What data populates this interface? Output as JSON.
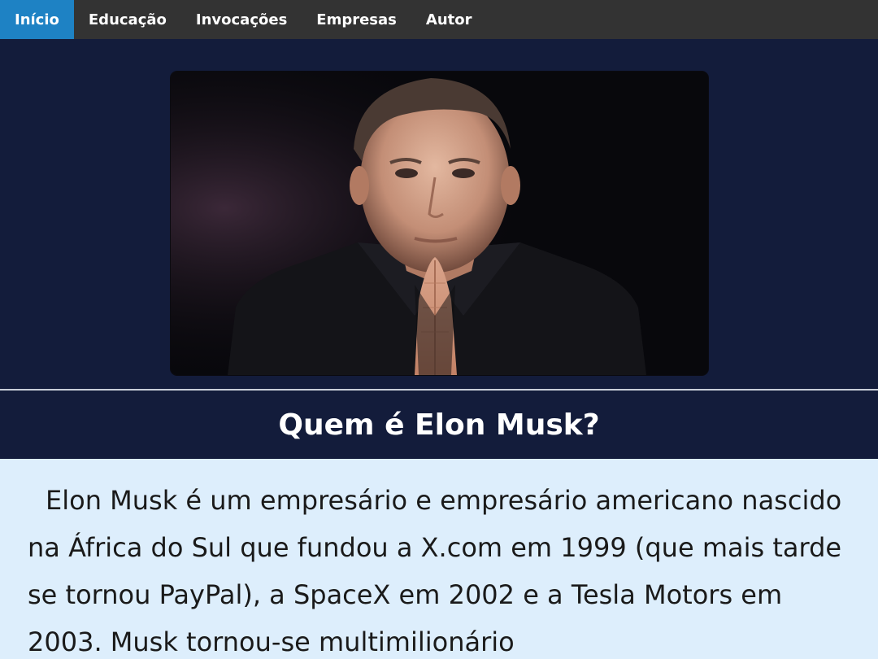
{
  "nav": {
    "items": [
      {
        "label": "Início",
        "active": true
      },
      {
        "label": "Educação",
        "active": false
      },
      {
        "label": "Invocações",
        "active": false
      },
      {
        "label": "Empresas",
        "active": false
      },
      {
        "label": "Autor",
        "active": false
      }
    ]
  },
  "hero": {
    "image_subject": "portrait-photo"
  },
  "main": {
    "title": "Quem é Elon Musk?",
    "paragraph": "Elon Musk é um empresário e empresário americano nascido na África do Sul que fundou a X.com em 1999 (que mais tarde se tornou PayPal), a SpaceX em 2002 e a Tesla Motors em 2003. Musk tornou-se multimilionário"
  },
  "colors": {
    "nav_bg": "#333333",
    "nav_active": "#1e82c4",
    "page_bg": "#131c3b",
    "content_bg": "#ddeefc"
  }
}
